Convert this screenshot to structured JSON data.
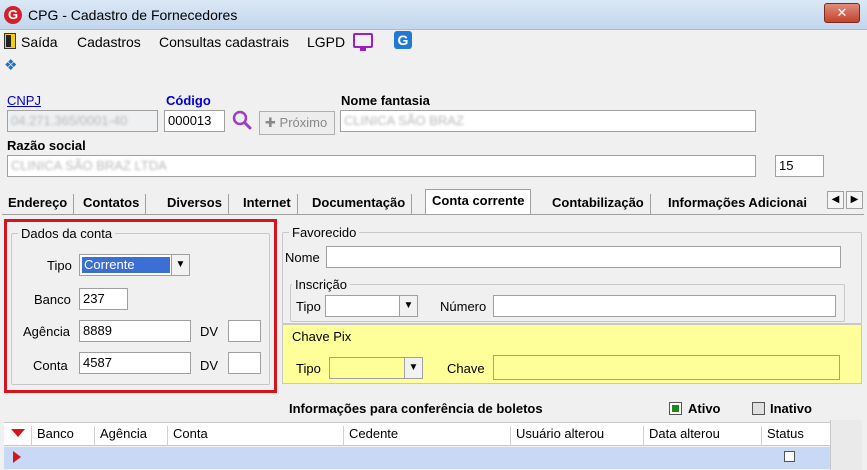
{
  "window": {
    "title": "CPG - Cadastro de Fornecedores",
    "icon_letter": "G",
    "close_glyph": "✕"
  },
  "menu": {
    "items": [
      "Saída",
      "Cadastros",
      "Consultas cadastrais",
      "LGPD"
    ],
    "g_icon_letter": "G"
  },
  "header": {
    "cnpj_label": "CNPJ",
    "cnpj_value": "04.271.365/0001-40",
    "codigo_label": "Código",
    "codigo_value": "000013",
    "proximo_label": "Próximo",
    "proximo_icon": "✚",
    "nome_fantasia_label": "Nome fantasia",
    "nome_fantasia_value": "CLINICA SÃO BRAZ",
    "razao_social_label": "Razão social",
    "razao_social_value": "CLINICA SÃO BRAZ LTDA",
    "extra_value": "15"
  },
  "tabs": [
    "Endereço",
    "Contatos",
    "Diversos",
    "Internet",
    "Documentação",
    "Conta corrente",
    "Contabilização",
    "Informações Adicionai"
  ],
  "tab_arrows": {
    "left": "◀",
    "right": "▶"
  },
  "active_tab": "Conta corrente",
  "dados_conta": {
    "title": "Dados da conta",
    "tipo_label": "Tipo",
    "tipo_value": "Corrente",
    "banco_label": "Banco",
    "banco_value": "237",
    "agencia_label": "Agência",
    "agencia_value": "8889",
    "conta_label": "Conta",
    "conta_value": "4587",
    "dv_label": "DV"
  },
  "favorecido": {
    "title": "Favorecido",
    "nome_label": "Nome",
    "inscricao_title": "Inscrição",
    "tipo_label": "Tipo",
    "numero_label": "Número"
  },
  "chave_pix": {
    "title": "Chave Pix",
    "tipo_label": "Tipo",
    "chave_label": "Chave"
  },
  "boletos": {
    "title": "Informações para conferência de boletos",
    "ativo_label": "Ativo",
    "inativo_label": "Inativo",
    "columns": [
      "Banco",
      "Agência",
      "Conta",
      "Cedente",
      "Usuário alterou",
      "Data alterou",
      "Status"
    ]
  },
  "colors": {
    "highlight_frame": "#d4151b",
    "pix_background": "#ffff99",
    "selected_row": "#c7d9f5",
    "link": "#0000cc"
  }
}
